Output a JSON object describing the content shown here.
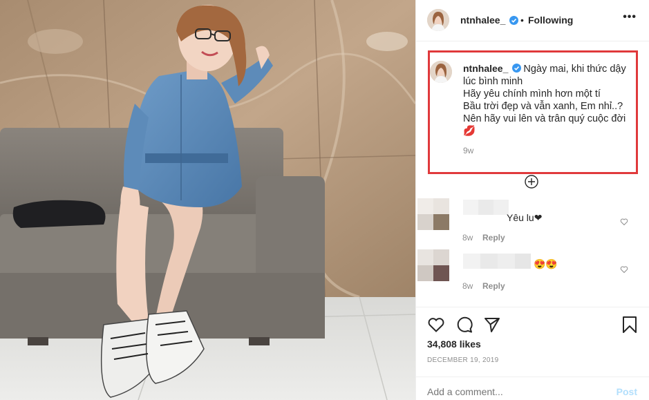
{
  "post": {
    "username": "ntnhalee_",
    "separator": "•",
    "follow_status": "Following",
    "more_label": "•••",
    "caption_lines": [
      "Ngày mai, khi thức dậy lúc bình minh",
      "Hãy yêu chính mình hơn một tí",
      "Bầu trời đẹp và vẫn xanh, Em nhỉ..?",
      "Nên hãy vui lên và trân quý cuộc đời",
      "💋"
    ],
    "caption_time": "9w"
  },
  "comments": [
    {
      "text": "Yêu lu❤",
      "time": "8w",
      "reply_label": "Reply"
    },
    {
      "text": "😍😍",
      "time": "8w",
      "reply_label": "Reply"
    }
  ],
  "footer": {
    "likes": "34,808 likes",
    "date": "DECEMBER 19, 2019",
    "comment_placeholder": "Add a comment...",
    "post_label": "Post"
  },
  "colors": {
    "highlight_border": "#e0393b",
    "verified_blue": "#3897f0",
    "muted": "#8e8e8e",
    "post_disabled": "#b2dffc"
  },
  "icons": {
    "verified": "verified-badge-icon",
    "load_more": "plus-circle-icon",
    "like": "heart-icon",
    "comment": "comment-bubble-icon",
    "share": "paper-plane-icon",
    "save": "bookmark-icon"
  }
}
